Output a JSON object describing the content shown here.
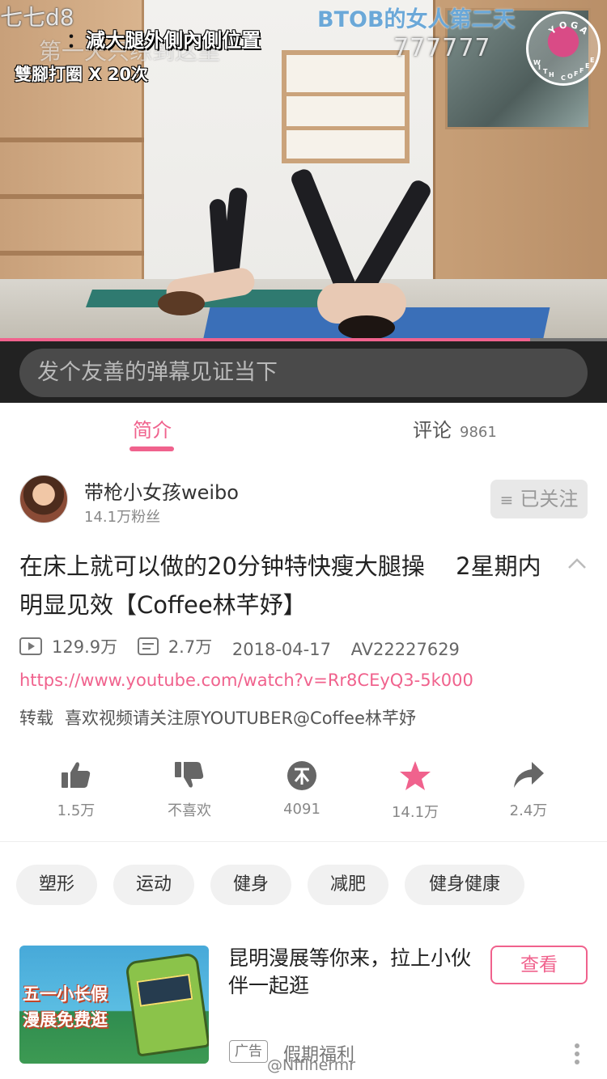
{
  "video": {
    "watermark_left": "七七d8",
    "overlay_subtitle": "第一天只练到这里",
    "overlay_title_prefix": "：",
    "overlay_title": "減大腿外側內側位置",
    "overlay_reps": "雙腳打圈 X 20次",
    "danmaku_btob": "BTOB的女人第二天",
    "danmaku_num": "777777",
    "logo_text": [
      "Y",
      "O",
      "G",
      "A",
      "W",
      "I",
      "T",
      "H",
      "C",
      "O",
      "F",
      "F",
      "E",
      "E"
    ],
    "progress_fraction": 0.873
  },
  "danmaku_input": {
    "placeholder": "发个友善的弹幕见证当下"
  },
  "tabs": {
    "intro": "简介",
    "comments": "评论",
    "comments_count": "9861"
  },
  "uploader": {
    "name": "带枪小女孩weibo",
    "fans": "14.1万粉丝",
    "follow_label": "已关注",
    "follow_icon": "menu-icon"
  },
  "video_info": {
    "title": "在床上就可以做的20分钟特快瘦大腿操　 2星期内明显见效【Coffee林芊妤】",
    "views": "129.9万",
    "danmaku": "2.7万",
    "date": "2018-04-17",
    "av_id": "AV22227629",
    "source_link": "https://www.youtube.com/watch?v=Rr8CEyQ3-5k000",
    "repost_label": "转载",
    "description": "喜欢视频请关注原YOUTUBER@Coffee林芊妤"
  },
  "actions": [
    {
      "icon": "thumbs-up-icon",
      "label": "1.5万"
    },
    {
      "icon": "thumbs-down-icon",
      "label": "不喜欢"
    },
    {
      "icon": "coin-icon",
      "label": "4091"
    },
    {
      "icon": "star-icon",
      "label": "14.1万"
    },
    {
      "icon": "share-icon",
      "label": "2.4万"
    }
  ],
  "tags": [
    "塑形",
    "运动",
    "健身",
    "减肥",
    "健身健康"
  ],
  "ad": {
    "image_text_1": "五一小长假",
    "image_text_2": "漫展免费逛",
    "title": "昆明漫展等你来，拉上小伙伴一起逛",
    "button": "查看",
    "badge": "广告",
    "source": "假期福利"
  },
  "weibo_watermark": "@Nfflhermr",
  "colors": {
    "accent": "#f0628d",
    "danmaku_bar": "#222222",
    "tag_bg": "#f1f1f1"
  }
}
